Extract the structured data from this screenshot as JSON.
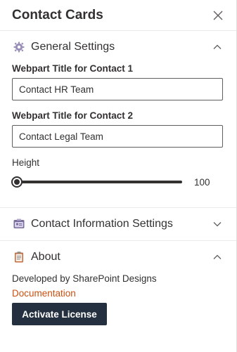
{
  "header": {
    "title": "Contact Cards"
  },
  "general": {
    "title": "General Settings",
    "icon": "gear-icon",
    "field1": {
      "label": "Webpart Title for Contact 1",
      "value": "Contact HR Team"
    },
    "field2": {
      "label": "Webpart Title for Contact 2",
      "value": "Contact Legal Team"
    },
    "height": {
      "label": "Height",
      "value": "100",
      "fraction": 0.0
    }
  },
  "contact_info": {
    "title": "Contact Information Settings",
    "icon": "contact-card-icon"
  },
  "about": {
    "title": "About",
    "icon": "clipboard-icon",
    "developer_text": "Developed by SharePoint Designs",
    "documentation_link": "Documentation",
    "license_button": "Activate License"
  },
  "colors": {
    "link": "#ca5010",
    "button_bg": "#24303f",
    "text": "#323130"
  }
}
